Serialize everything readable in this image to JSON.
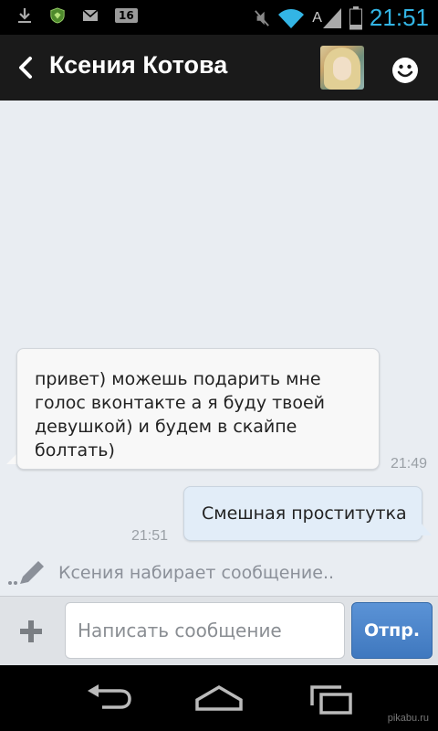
{
  "status_bar": {
    "battery_badge": "16",
    "clock": "21:51",
    "network_letter": "A",
    "icons": [
      "download-icon",
      "shield-icon",
      "mail-icon",
      "battery-badge",
      "mute-icon",
      "wifi-icon",
      "signal-icon",
      "battery-icon"
    ]
  },
  "header": {
    "title": "Ксения Котова",
    "back_icon": "chevron-left-icon",
    "avatar": "contact-avatar",
    "emoji_icon": "smiley-icon"
  },
  "messages": [
    {
      "direction": "incoming",
      "text": "привет) можешь подарить мне голос вконтакте а я буду твоей девушкой) и будем в скайпе болтать)",
      "time": "21:49"
    },
    {
      "direction": "outgoing",
      "text": "Смешная проститутка",
      "time": "21:51"
    }
  ],
  "typing_indicator": "Ксения набирает сообщение..",
  "composer": {
    "placeholder": "Написать сообщение",
    "send_label": "Отпр.",
    "attach_icon": "plus-icon"
  },
  "navbar": {
    "icons": [
      "back-icon",
      "home-icon",
      "recent-apps-icon"
    ]
  },
  "watermark": "pikabu.ru",
  "colors": {
    "accent_blue": "#33b5e5",
    "send_button": "#4a84c9",
    "chat_background": "#e9edf2",
    "outgoing_bubble": "#e2edf8"
  }
}
